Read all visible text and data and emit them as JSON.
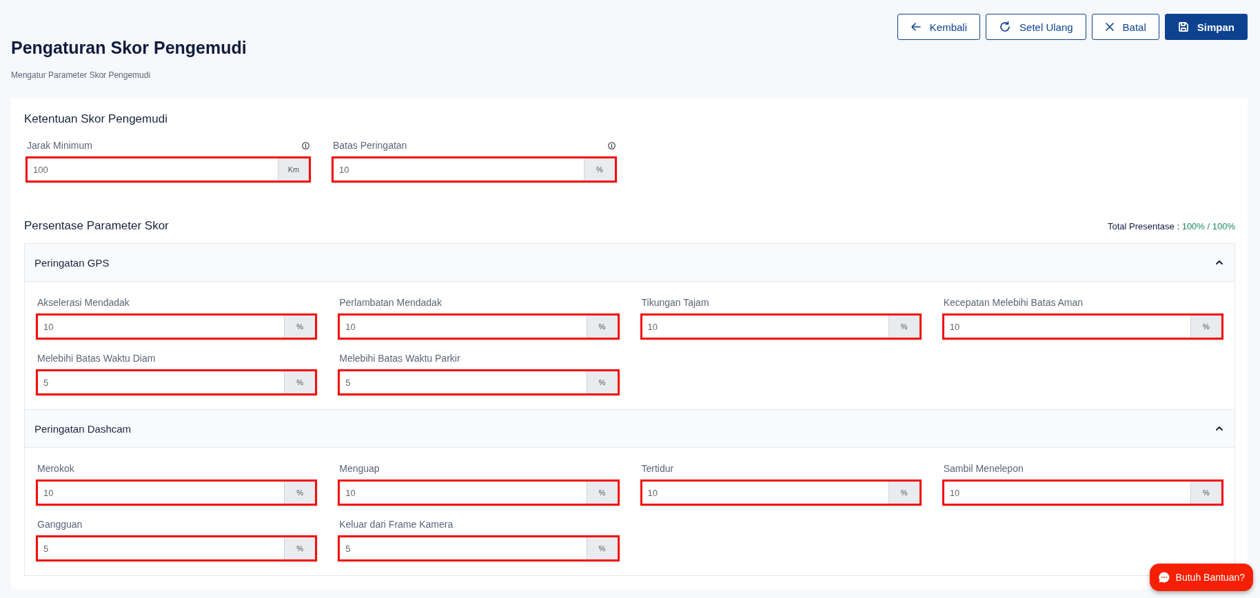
{
  "page": {
    "title": "Pengaturan Skor Pengemudi",
    "subtitle": "Mengatur Parameter Skor Pengemudi"
  },
  "buttons": [
    {
      "label": "Kembali",
      "kind": "back"
    },
    {
      "label": "Setel Ulang",
      "kind": "reset"
    },
    {
      "label": "Batal",
      "kind": "cancel"
    },
    {
      "label": "Simpan",
      "kind": "save"
    }
  ],
  "rules": {
    "title": "Ketentuan Skor Pengemudi",
    "fields": [
      {
        "label": "Jarak Minimum",
        "value": "100",
        "unit": "Km",
        "info": true,
        "highlighted": true
      },
      {
        "label": "Batas Peringatan",
        "value": "10",
        "unit": "%",
        "info": true,
        "highlighted": true
      }
    ]
  },
  "parameters": {
    "title": "Persentase Parameter Skor",
    "total_label": "Total Presentase :",
    "total_value": "100% / 100%",
    "sections": [
      {
        "title": "Peringatan GPS",
        "expanded": true,
        "fields": [
          {
            "label": "Akselerasi Mendadak",
            "value": "10",
            "unit": "%",
            "highlighted": true
          },
          {
            "label": "Perlambatan Mendadak",
            "value": "10",
            "unit": "%",
            "highlighted": true
          },
          {
            "label": "Tikungan Tajam",
            "value": "10",
            "unit": "%",
            "highlighted": true
          },
          {
            "label": "Kecepatan Melebihi Batas Aman",
            "value": "10",
            "unit": "%",
            "highlighted": true
          },
          {
            "label": "Melebihi Batas Waktu Diam",
            "value": "5",
            "unit": "%",
            "highlighted": true
          },
          {
            "label": "Melebihi Batas Waktu Parkir",
            "value": "5",
            "unit": "%",
            "highlighted": true
          }
        ]
      },
      {
        "title": "Peringatan Dashcam",
        "expanded": true,
        "fields": [
          {
            "label": "Merokok",
            "value": "10",
            "unit": "%",
            "highlighted": true
          },
          {
            "label": "Menguap",
            "value": "10",
            "unit": "%",
            "highlighted": true
          },
          {
            "label": "Tertidur",
            "value": "10",
            "unit": "%",
            "highlighted": true
          },
          {
            "label": "Sambil Menelepon",
            "value": "10",
            "unit": "%",
            "highlighted": true
          },
          {
            "label": "Gangguan",
            "value": "5",
            "unit": "%",
            "highlighted": true
          },
          {
            "label": "Keluar dari Frame Kamera",
            "value": "5",
            "unit": "%",
            "highlighted": true
          }
        ]
      }
    ]
  },
  "help_button": {
    "label": "Butuh Bantuan?"
  }
}
